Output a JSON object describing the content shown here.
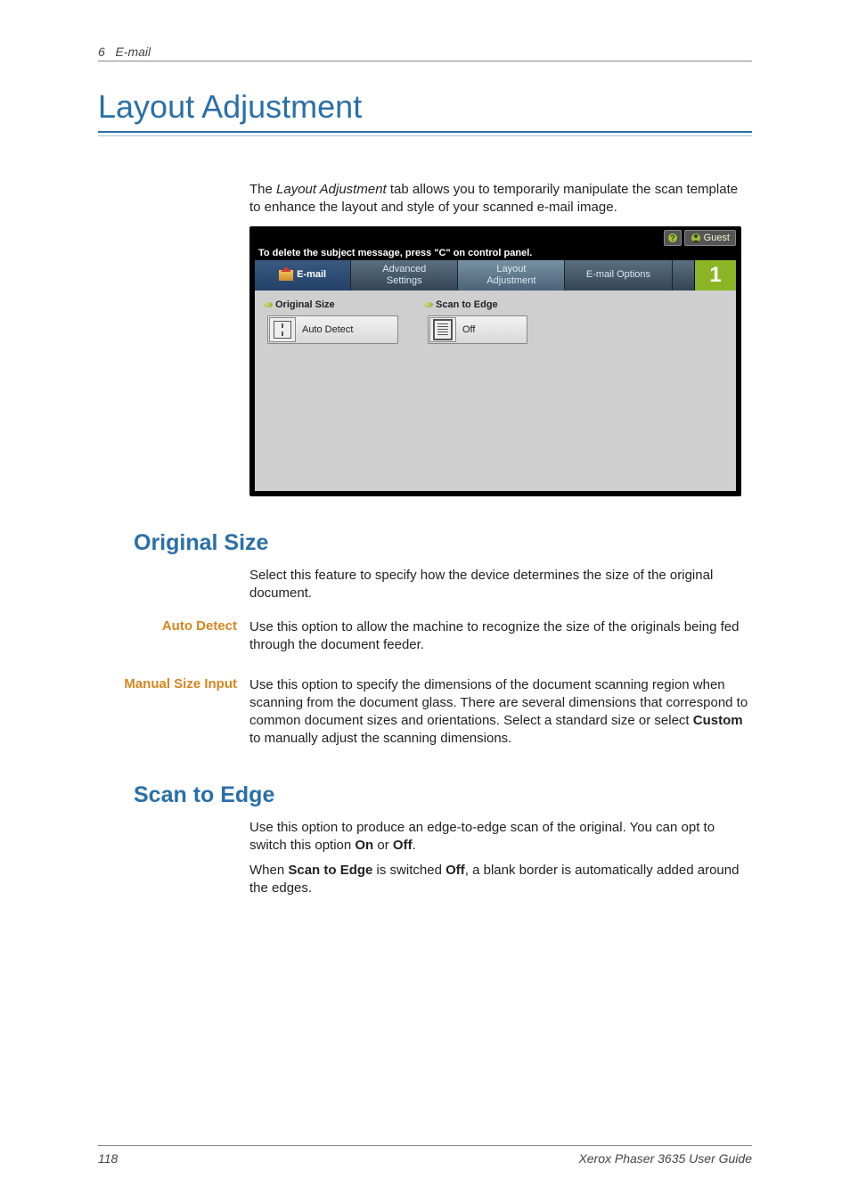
{
  "header": {
    "chapter_num": "6",
    "chapter_title": "E-mail"
  },
  "title": "Layout Adjustment",
  "intro_pre": "The ",
  "intro_em": "Layout Adjustment",
  "intro_post": " tab allows you to temporarily manipulate the scan template to enhance the layout and style of your scanned e-mail image.",
  "screenshot": {
    "guest": "Guest",
    "hint": "To delete the subject message, press \"C\" on control panel.",
    "tabs": [
      "E-mail",
      "Advanced\nSettings",
      "Layout\nAdjustment",
      "E-mail Options"
    ],
    "count": "1",
    "group1_label": "Original Size",
    "group1_value": "Auto Detect",
    "group2_label": "Scan to Edge",
    "group2_value": "Off"
  },
  "sections": {
    "original_size": {
      "heading": "Original Size",
      "intro": "Select this feature to specify how the device determines the size of the original document.",
      "auto_detect_label": "Auto Detect",
      "auto_detect_text": "Use this option to allow the machine to recognize the size of the originals being fed through the document feeder.",
      "manual_label": "Manual Size Input",
      "manual_text_pre": "Use this option to specify the dimensions of the document scanning region when scanning from the document glass. There are several dimensions that correspond to common document sizes and orientations. Select a standard size or select ",
      "manual_text_bold": "Custom",
      "manual_text_post": " to manually adjust the scanning dimensions."
    },
    "scan_to_edge": {
      "heading": "Scan to Edge",
      "p1_pre": "Use this option to produce an edge-to-edge scan of the original. You can opt to switch this option ",
      "p1_b1": "On",
      "p1_mid": " or ",
      "p1_b2": "Off",
      "p1_post": ".",
      "p2_pre": "When ",
      "p2_b1": "Scan to Edge",
      "p2_mid": " is switched ",
      "p2_b2": "Off",
      "p2_post": ", a blank border is automatically added around the edges."
    }
  },
  "footer": {
    "page": "118",
    "doc": "Xerox Phaser 3635 User Guide"
  }
}
